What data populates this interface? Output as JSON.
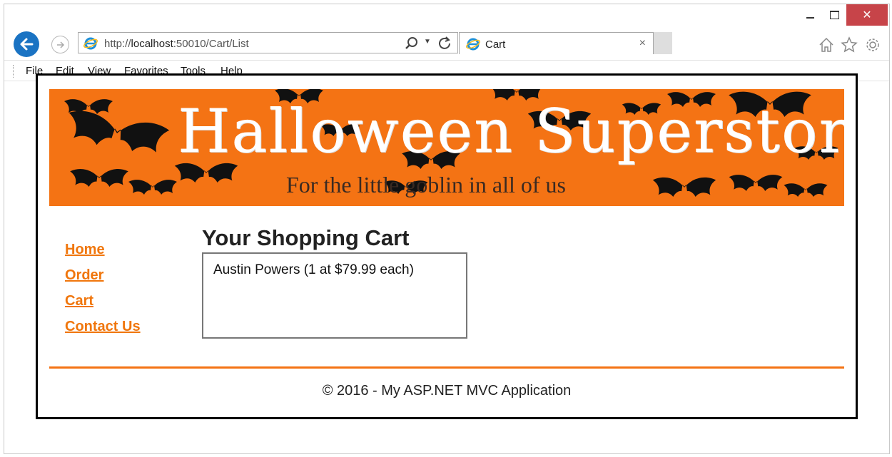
{
  "window": {
    "minimize_label": "_",
    "close_label": "✕"
  },
  "address_bar": {
    "url_prefix": "http://",
    "url_host": "localhost",
    "url_path": ":50010/Cart/List"
  },
  "tab": {
    "title": "Cart",
    "close_label": "×"
  },
  "menu": [
    "File",
    "Edit",
    "View",
    "Favorites",
    "Tools",
    "Help"
  ],
  "banner": {
    "title": "Halloween Superstore",
    "tagline": "For the little goblin in all of us"
  },
  "nav": {
    "home": "Home",
    "order": "Order",
    "cart": "Cart",
    "contact": "Contact Us"
  },
  "cart": {
    "heading": "Your Shopping Cart",
    "items": [
      "Austin Powers (1 at $79.99 each)"
    ]
  },
  "footer": {
    "text": "© 2016 - My ASP.NET MVC Application"
  },
  "colors": {
    "accent": "#f47314",
    "link": "#f0760c",
    "close_button": "#c74449",
    "back_button": "#1a73c3"
  },
  "icons": [
    "back-arrow-icon",
    "forward-arrow-icon",
    "ie-logo-icon",
    "search-icon",
    "refresh-icon",
    "home-icon",
    "favorites-star-icon",
    "settings-gear-icon",
    "bat-icon"
  ]
}
